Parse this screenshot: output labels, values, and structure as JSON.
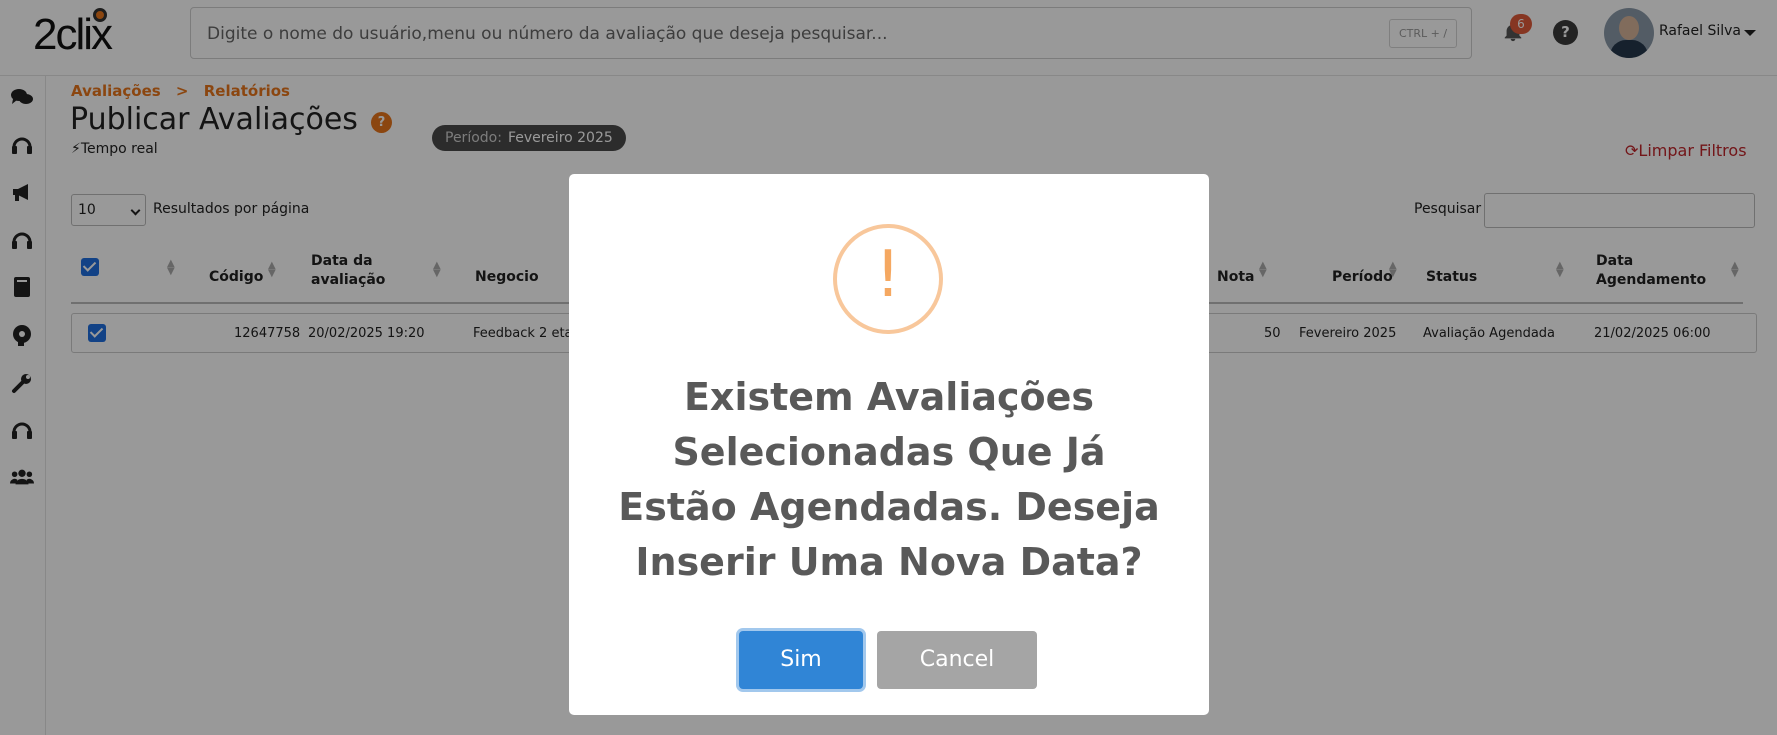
{
  "header": {
    "logo": "2clix",
    "search_placeholder": "Digite o nome do usuário,menu ou número da avaliação que deseja pesquisar...",
    "shortcut": "CTRL + /",
    "notification_count": "6",
    "help": "?",
    "user_name": "Rafael Silva"
  },
  "breadcrumb": [
    "Avaliações",
    ">",
    "Relatórios"
  ],
  "page": {
    "title": "Publicar Avaliações",
    "title_help": "?",
    "realtime": "Tempo real",
    "period_label": "Período:",
    "period_value": "Fevereiro 2025",
    "clear_filters": "Limpar Filtros"
  },
  "table_controls": {
    "per_page_value": "10",
    "per_page_label": "Resultados por página",
    "search_label": "Pesquisar"
  },
  "table": {
    "headers": {
      "codigo": "Código",
      "data_avaliacao_1": "Data da",
      "data_avaliacao_2": "avaliação",
      "negocio": "Negocio",
      "nota": "Nota",
      "periodo": "Período",
      "status": "Status",
      "data_agendamento_1": "Data",
      "data_agendamento_2": "Agendamento"
    },
    "rows": [
      {
        "codigo": "12647758",
        "data": "20/02/2025 19:20",
        "negocio": "Feedback 2 eta",
        "nota": "50",
        "periodo": "Fevereiro 2025",
        "status": "Avaliação Agendada",
        "agendamento": "21/02/2025 06:00"
      }
    ]
  },
  "modal": {
    "icon": "!",
    "message": "Existem Avaliações Selecionadas Que Já Estão Agendadas. Deseja Inserir Uma Nova Data?",
    "confirm_label": "Sim",
    "cancel_label": "Cancel"
  },
  "colors": {
    "accent_orange": "#e8761c",
    "confirm_blue": "#3085d6",
    "cancel_gray": "#a5a5a5",
    "clear_red": "#c0252b",
    "checkbox_blue": "#1f6fe0"
  }
}
